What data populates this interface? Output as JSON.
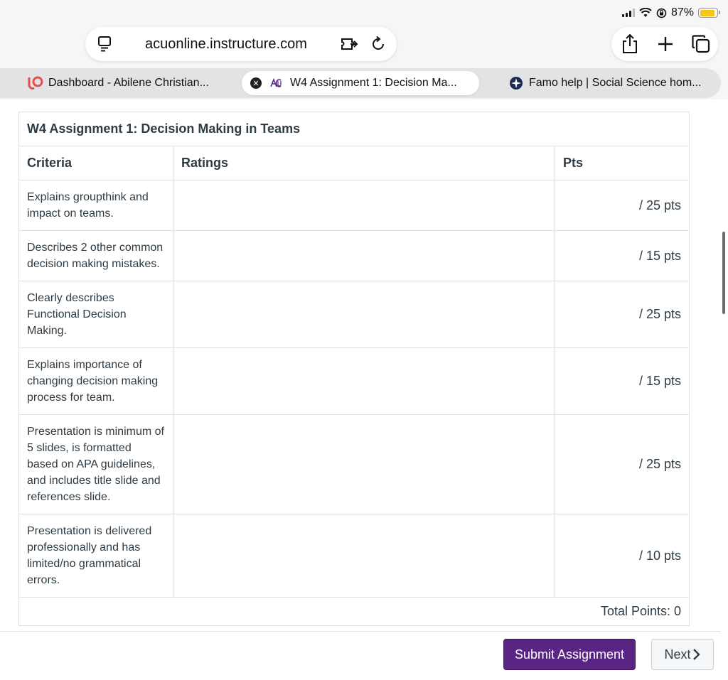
{
  "status_bar": {
    "battery_text": "87%",
    "battery_level": 0.87
  },
  "browser": {
    "url": "acuonline.instructure.com",
    "tabs": [
      {
        "label": "Dashboard - Abilene Christian...",
        "active": false
      },
      {
        "label": "W4 Assignment 1: Decision Ma...",
        "active": true
      },
      {
        "label": "Famo help | Social Science hom...",
        "active": false
      }
    ],
    "icons": {
      "reader": "reader-mode-icon",
      "extension": "extension-icon",
      "reload": "reload-icon",
      "share": "share-icon",
      "new_tab": "plus-icon",
      "tabs": "tab-overview-icon"
    }
  },
  "rubric": {
    "title": "W4 Assignment 1: Decision Making in Teams",
    "headers": {
      "criteria": "Criteria",
      "ratings": "Ratings",
      "pts": "Pts"
    },
    "rows": [
      {
        "criteria": "Explains groupthink and impact on teams.",
        "ratings": "",
        "pts": "/ 25 pts"
      },
      {
        "criteria": "Describes 2 other common decision making mistakes.",
        "ratings": "",
        "pts": "/ 15 pts"
      },
      {
        "criteria": "Clearly describes Functional Decision Making.",
        "ratings": "",
        "pts": "/ 25 pts"
      },
      {
        "criteria": "Explains importance of changing decision making process for team.",
        "ratings": "",
        "pts": "/ 15 pts"
      },
      {
        "criteria": "Presentation is minimum of 5 slides, is formatted based on APA guidelines, and includes title slide and references slide.",
        "ratings": "",
        "pts": "/ 25 pts"
      },
      {
        "criteria": "Presentation is delivered professionally and has limited/no grammatical errors.",
        "ratings": "",
        "pts": "/ 10 pts"
      }
    ],
    "total": "Total Points: 0"
  },
  "footer": {
    "submit_label": "Submit Assignment",
    "next_label": "Next"
  },
  "colors": {
    "submit_bg": "#5a2582",
    "text": "#2d3b45",
    "border": "#dde1e4",
    "battery": "#f5c518",
    "canvas_logo": "#e4514c"
  }
}
